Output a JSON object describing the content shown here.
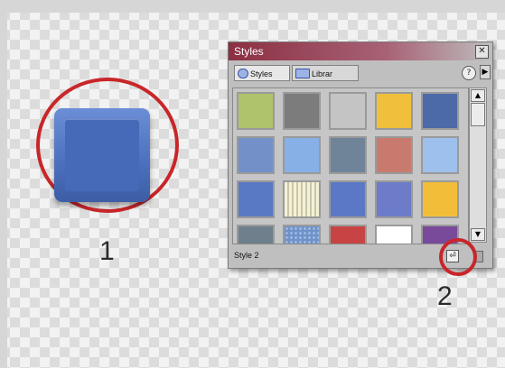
{
  "callouts": {
    "one": "1",
    "two": "2"
  },
  "panel": {
    "title": "Styles",
    "close_glyph": "✕",
    "tabs": [
      {
        "label": "Styles"
      },
      {
        "label": "Librar"
      }
    ],
    "help_glyph": "?",
    "menu_arrow_glyph": "▶",
    "status_label": "Style 2",
    "swatch_colors": [
      [
        "#aec36c",
        "#7c7c7c",
        "#c4c4c4",
        "#f0bf3c",
        "#4c6aa8"
      ],
      [
        "#7391c8",
        "#87b0e6",
        "#6f8499",
        "#c97a6e",
        "#9ec0ec"
      ],
      [
        "#5a79c4",
        "striped",
        "#5a78c6",
        "#6c7cc8",
        "#f2be3a"
      ],
      [
        "#6f7f8c",
        "texture",
        "#c84444",
        "#ffffff",
        "#7a4a9a"
      ]
    ]
  },
  "colors": {
    "highlight": "#c8262a",
    "demo_blue": "#4c6fbd"
  }
}
